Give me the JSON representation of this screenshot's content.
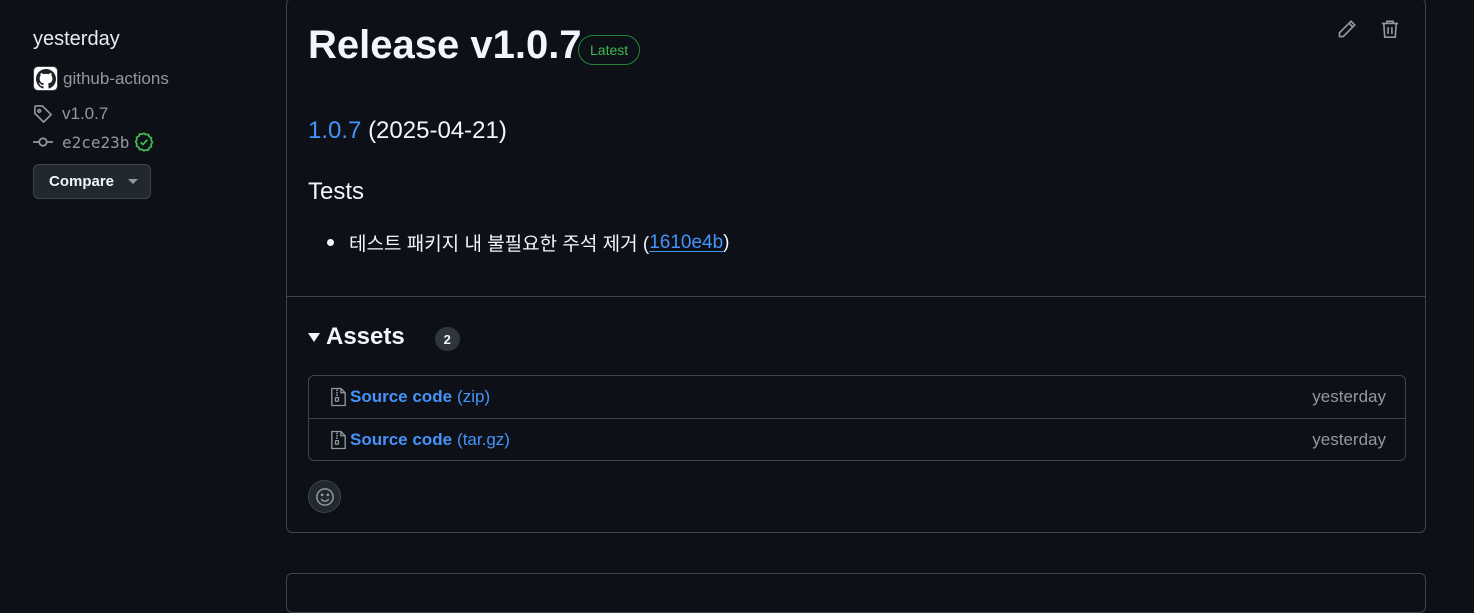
{
  "sidebar": {
    "date": "yesterday",
    "author": "github-actions",
    "tag": "v1.0.7",
    "commit": "e2ce23b",
    "compare_label": "Compare"
  },
  "release": {
    "title": "Release v1.0.7",
    "badge": "Latest",
    "version_link": "1.0.7",
    "version_date": "(2025-04-21)",
    "section_heading": "Tests",
    "items": [
      {
        "text": "테스트 패키지 내 불필요한 주석 제거 (",
        "commit_link": "1610e4b",
        "suffix": ")"
      }
    ]
  },
  "assets": {
    "title": "Assets",
    "count": "2",
    "files": [
      {
        "name": "Source code",
        "ext": "(zip)",
        "date": "yesterday"
      },
      {
        "name": "Source code",
        "ext": "(tar.gz)",
        "date": "yesterday"
      }
    ]
  },
  "colors": {
    "background": "#0d1117",
    "border": "#3d444d",
    "link": "#4493f8",
    "success": "#3fb950",
    "muted": "#9198a1"
  }
}
